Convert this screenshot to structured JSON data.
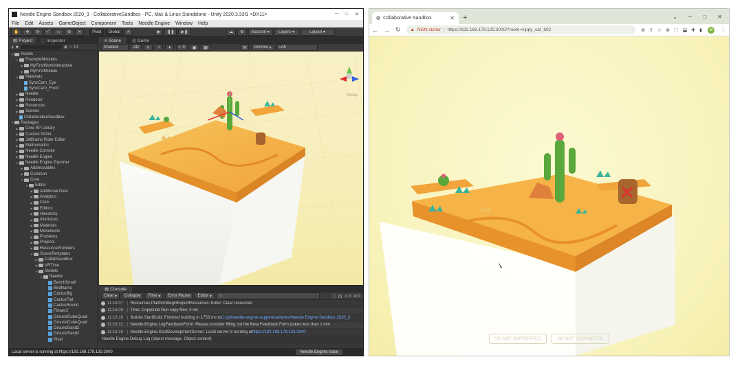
{
  "unity": {
    "title": "Needle Engine Sandbox 2020_3 - CollaborativeSandbox - PC, Mac & Linux Standalone - Unity 2020.3.33f1 <DX11>",
    "menu": [
      "File",
      "Edit",
      "Assets",
      "GameObject",
      "Component",
      "Tools",
      "Needle Engine",
      "Window",
      "Help"
    ],
    "toolbar": {
      "pivot": "Pivot",
      "global": "Global",
      "account": "Account",
      "layers": "Layers",
      "layout": "Layout"
    },
    "panel_tabs": {
      "project": "Project",
      "inspector": "Inspector"
    },
    "tree": [
      {
        "label": "Assets",
        "depth": 0,
        "kind": "folder",
        "open": true
      },
      {
        "label": "ExampleModules",
        "depth": 1,
        "kind": "folder",
        "open": true
      },
      {
        "label": "MyFirstWorkInteractive",
        "depth": 2,
        "kind": "folder"
      },
      {
        "label": "MyFirstModule",
        "depth": 2,
        "kind": "folder"
      },
      {
        "label": "Materials",
        "depth": 1,
        "kind": "folder",
        "open": true
      },
      {
        "label": "SyncCam_Eye",
        "depth": 2,
        "kind": "file"
      },
      {
        "label": "SyncCam_Front",
        "depth": 2,
        "kind": "file"
      },
      {
        "label": "Needle",
        "depth": 1,
        "kind": "folder"
      },
      {
        "label": "Renderer",
        "depth": 1,
        "kind": "folder"
      },
      {
        "label": "Resources",
        "depth": 1,
        "kind": "folder"
      },
      {
        "label": "Scenes",
        "depth": 1,
        "kind": "folder"
      },
      {
        "label": "CollaborativeSandbox",
        "depth": 1,
        "kind": "file"
      },
      {
        "label": "Packages",
        "depth": 0,
        "kind": "folder",
        "open": true
      },
      {
        "label": "Core RP Library",
        "depth": 1,
        "kind": "folder"
      },
      {
        "label": "Custom NUnit",
        "depth": 1,
        "kind": "folder"
      },
      {
        "label": "JetBrains Rider Editor",
        "depth": 1,
        "kind": "folder"
      },
      {
        "label": "Mathematics",
        "depth": 1,
        "kind": "folder"
      },
      {
        "label": "Needle Console",
        "depth": 1,
        "kind": "folder"
      },
      {
        "label": "Needle Engine",
        "depth": 1,
        "kind": "folder"
      },
      {
        "label": "Needle Engine Exporter",
        "depth": 1,
        "kind": "folder",
        "open": true
      },
      {
        "label": "Addressables",
        "depth": 2,
        "kind": "folder"
      },
      {
        "label": "Common",
        "depth": 2,
        "kind": "folder"
      },
      {
        "label": "Core",
        "depth": 2,
        "kind": "folder",
        "open": true
      },
      {
        "label": "Editor",
        "depth": 3,
        "kind": "folder",
        "open": true
      },
      {
        "label": "Additional Data",
        "depth": 4,
        "kind": "folder"
      },
      {
        "label": "Analytics",
        "depth": 4,
        "kind": "folder"
      },
      {
        "label": "Core",
        "depth": 4,
        "kind": "folder"
      },
      {
        "label": "Editors",
        "depth": 4,
        "kind": "folder"
      },
      {
        "label": "Hierarchy",
        "depth": 4,
        "kind": "folder"
      },
      {
        "label": "Interfaces",
        "depth": 4,
        "kind": "folder"
      },
      {
        "label": "Materials",
        "depth": 4,
        "kind": "folder"
      },
      {
        "label": "Menuitems",
        "depth": 4,
        "kind": "folder"
      },
      {
        "label": "Problems",
        "depth": 4,
        "kind": "folder"
      },
      {
        "label": "Projects",
        "depth": 4,
        "kind": "folder"
      },
      {
        "label": "ResourceProviders",
        "depth": 4,
        "kind": "folder"
      },
      {
        "label": "SceneTemplates",
        "depth": 4,
        "kind": "folder",
        "open": true
      },
      {
        "label": "CollabSandbox",
        "depth": 5,
        "kind": "folder"
      },
      {
        "label": "VRTime",
        "depth": 5,
        "kind": "folder"
      },
      {
        "label": "Models",
        "depth": 5,
        "kind": "folder",
        "open": true
      },
      {
        "label": "Needle",
        "depth": 6,
        "kind": "folder",
        "open": true
      },
      {
        "label": "BenchSmall",
        "depth": 7,
        "kind": "prefab"
      },
      {
        "label": "BirdName",
        "depth": 7,
        "kind": "prefab"
      },
      {
        "label": "CactusBig",
        "depth": 7,
        "kind": "prefab"
      },
      {
        "label": "CactusFlat",
        "depth": 7,
        "kind": "prefab"
      },
      {
        "label": "CactusRound",
        "depth": 7,
        "kind": "prefab"
      },
      {
        "label": "Flower2",
        "depth": 7,
        "kind": "prefab"
      },
      {
        "label": "GroundCubeQuad",
        "depth": 7,
        "kind": "prefab"
      },
      {
        "label": "GroundCubeQuad",
        "depth": 7,
        "kind": "prefab"
      },
      {
        "label": "GroundSand2",
        "depth": 7,
        "kind": "prefab"
      },
      {
        "label": "GroundSand2",
        "depth": 7,
        "kind": "prefab"
      },
      {
        "label": "Pixel",
        "depth": 7,
        "kind": "prefab"
      }
    ],
    "scene_tabs": {
      "scene": "Scene",
      "game": "Game"
    },
    "scene_toolbar": {
      "shaded": "Shaded",
      "mode": "2D",
      "gizmos": "Gizmos",
      "search": "All"
    },
    "persp_label": "Persp",
    "console": {
      "tab": "Console",
      "clear": "Clear",
      "collapse": "Collapse",
      "filter": "Filter",
      "error_pause": "Error Pause",
      "editor": "Editor",
      "count_log": "72",
      "count_warn": "0",
      "count_error": "0",
      "lines": [
        {
          "time": "11:16:07",
          "text": "Resources.PlatformBeginExportResources: Enter: Clear resources"
        },
        {
          "time": "11:16:08",
          "text": "Time: CopyGlob Run copy files: 4 ms"
        },
        {
          "time": "11:16:16",
          "text": "Builder.StartBuild: Finished building in 1753 ms to ",
          "link": "C:/git/needle-engine-support/samples/Needle Engine Sandbox 2020_3"
        },
        {
          "time": "11:16:22",
          "text": "Needle.Engine.LogFeedbackForm: Please consider filling out the Beta Feedback Form (takes less than 1 min"
        },
        {
          "time": "11:16:26",
          "text": "Needle.Engine.StartDevelopmentServer: Local server is running at ",
          "link": "https://192.168.178.125:3000"
        }
      ],
      "footer_line": "Needle Engine Debug Log (object message, Object context)"
    },
    "status": {
      "text": "Local server is running at https://192.168.178.125:3000",
      "env": "Needle Engine: base"
    }
  },
  "chrome": {
    "tab_title": "Collaborative Sandbox",
    "not_secure": "Nicht sicher",
    "url": "https://192.168.178.125:3000/?room=zippy_cat_602",
    "avatar": "M",
    "buttons": {
      "vr": "VR NOT SUPPORTED",
      "ar": "AR NOT SUPPORTED"
    }
  },
  "colors": {
    "unity_bg": "#383838",
    "scene_bg": "#f6eeb8",
    "sand": "#f5a623",
    "cube": "#f2f2f0",
    "chrome_page": "#f8f3bc",
    "cactus": "#5aa83c"
  }
}
